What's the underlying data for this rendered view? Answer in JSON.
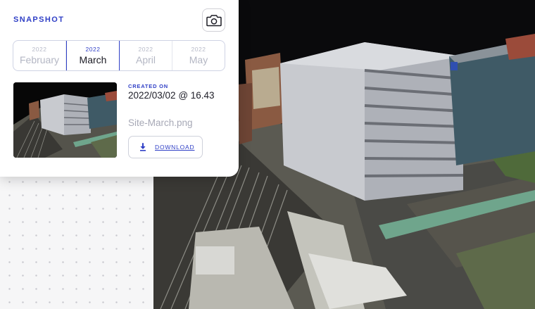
{
  "snapshot": {
    "title": "SNAPSHOT",
    "camera_icon": "camera-icon",
    "months": [
      {
        "year": "2022",
        "month": "February",
        "active": false
      },
      {
        "year": "2022",
        "month": "March",
        "active": true
      },
      {
        "year": "2022",
        "month": "April",
        "active": false
      },
      {
        "year": "2022",
        "month": "May",
        "active": false
      }
    ],
    "created_label": "CREATED ON",
    "created_value": "2022/03/02 @ 16.43",
    "filename": "Site-March.png",
    "download_label": "DOWNLOAD",
    "download_icon": "download-icon"
  },
  "colors": {
    "accent": "#2f3fc6",
    "card_bg": "#ffffff",
    "scene_bg": "#0a0a0c"
  }
}
